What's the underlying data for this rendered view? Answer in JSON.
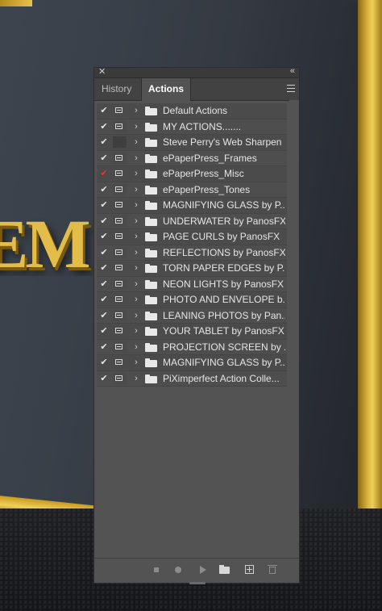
{
  "background": {
    "description_letters": "EM"
  },
  "panel": {
    "close_glyph": "✕",
    "collapse_glyph": "«",
    "tabs": [
      {
        "label": "History"
      },
      {
        "label": "Actions"
      }
    ],
    "actions": [
      {
        "name": "Default Actions",
        "checked": true,
        "dialog": true
      },
      {
        "name": "MY ACTIONS.......",
        "checked": true,
        "dialog": true
      },
      {
        "name": "Steve Perry's Web Sharpen",
        "checked": true,
        "dialog": false
      },
      {
        "name": "ePaperPress_Frames",
        "checked": true,
        "dialog": true
      },
      {
        "name": "ePaperPress_Misc",
        "checked": "partial",
        "dialog": true
      },
      {
        "name": "ePaperPress_Tones",
        "checked": true,
        "dialog": true
      },
      {
        "name": "MAGNIFYING GLASS by P...",
        "checked": true,
        "dialog": true
      },
      {
        "name": "UNDERWATER by PanosFX",
        "checked": true,
        "dialog": true
      },
      {
        "name": "PAGE CURLS by PanosFX",
        "checked": true,
        "dialog": true
      },
      {
        "name": "REFLECTIONS by PanosFX",
        "checked": true,
        "dialog": true
      },
      {
        "name": "TORN PAPER EDGES by P...",
        "checked": true,
        "dialog": true
      },
      {
        "name": "NEON LIGHTS by PanosFX",
        "checked": true,
        "dialog": true
      },
      {
        "name": "PHOTO AND ENVELOPE b...",
        "checked": true,
        "dialog": true
      },
      {
        "name": "LEANING PHOTOS by Pan...",
        "checked": true,
        "dialog": true
      },
      {
        "name": "YOUR TABLET by PanosFX",
        "checked": true,
        "dialog": true
      },
      {
        "name": "PROJECTION SCREEN by ...",
        "checked": true,
        "dialog": true
      },
      {
        "name": "MAGNIFYING GLASS by P...",
        "checked": true,
        "dialog": true
      },
      {
        "name": "PiXimperfect Action Colle...",
        "checked": true,
        "dialog": true
      }
    ],
    "footer_buttons": [
      {
        "icon": "stop-icon"
      },
      {
        "icon": "record-icon"
      },
      {
        "icon": "play-icon"
      },
      {
        "icon": "new-set-folder-icon"
      },
      {
        "icon": "new-action-icon"
      },
      {
        "icon": "trash-icon"
      }
    ],
    "colors": {
      "panel_bg": "#535353",
      "partial_check": "#e23a3a"
    }
  }
}
